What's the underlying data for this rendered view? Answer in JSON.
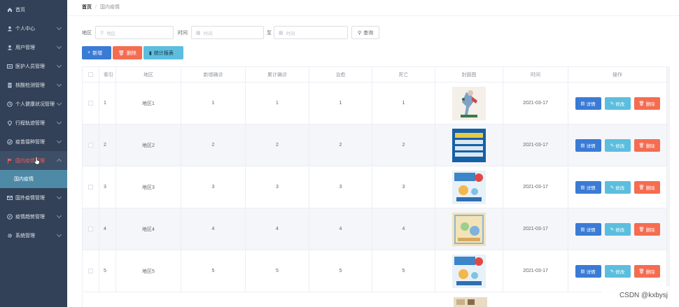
{
  "sidebar": {
    "items": [
      {
        "label": "首页",
        "icon": "home-icon",
        "arrow": false
      },
      {
        "label": "个人中心",
        "icon": "user-icon",
        "arrow": true
      },
      {
        "label": "用户管理",
        "icon": "user-icon",
        "arrow": true
      },
      {
        "label": "医护人员管理",
        "icon": "card-icon",
        "arrow": true
      },
      {
        "label": "核酸检测管理",
        "icon": "doc-icon",
        "arrow": true
      },
      {
        "label": "个人健康状况管理",
        "icon": "health-icon",
        "arrow": true
      },
      {
        "label": "行程轨迹管理",
        "icon": "location-icon",
        "arrow": true
      },
      {
        "label": "疫苗接种管理",
        "icon": "shield-icon",
        "arrow": true
      },
      {
        "label": "国内疫情管理",
        "icon": "flag-icon",
        "arrow": true,
        "active": true
      },
      {
        "label": "国外疫情管理",
        "icon": "mail-icon",
        "arrow": true
      },
      {
        "label": "疫情趋势管理",
        "icon": "compass-icon",
        "arrow": true
      },
      {
        "label": "系统管理",
        "icon": "gear-icon",
        "arrow": true
      }
    ],
    "submenu_label": "国内疫情"
  },
  "breadcrumb": {
    "home": "首页",
    "sep": "/",
    "current": "国内疫情"
  },
  "search": {
    "region_label": "地区",
    "region_placeholder": "地区",
    "time_label": "时间",
    "time_start_placeholder": "时间",
    "to_label": "至",
    "time_end_placeholder": "时间",
    "query_label": "查询"
  },
  "actions": {
    "add": "新增",
    "delete": "删除",
    "report": "统计报表"
  },
  "table": {
    "headers": [
      "索引",
      "地区",
      "新增确诊",
      "累计确诊",
      "治愈",
      "死亡",
      "封面图",
      "时间",
      "操作"
    ],
    "rows": [
      {
        "index": "1",
        "region": "地区1",
        "new_confirmed": "1",
        "total_confirmed": "1",
        "cured": "1",
        "deaths": "1",
        "time": "2021-03-17"
      },
      {
        "index": "2",
        "region": "地区2",
        "new_confirmed": "2",
        "total_confirmed": "2",
        "cured": "2",
        "deaths": "2",
        "time": "2021-03-17"
      },
      {
        "index": "3",
        "region": "地区3",
        "new_confirmed": "3",
        "total_confirmed": "3",
        "cured": "3",
        "deaths": "3",
        "time": "2021-03-17"
      },
      {
        "index": "4",
        "region": "地区4",
        "new_confirmed": "4",
        "total_confirmed": "4",
        "cured": "4",
        "deaths": "4",
        "time": "2021-03-17"
      },
      {
        "index": "5",
        "region": "地区5",
        "new_confirmed": "5",
        "total_confirmed": "5",
        "cured": "5",
        "deaths": "5",
        "time": "2021-03-17"
      }
    ],
    "row_actions": {
      "detail": "详情",
      "edit": "修改",
      "delete": "删除"
    }
  },
  "watermark": "CSDN @kxbysj",
  "colors": {
    "sidebar_bg": "#324157",
    "primary": "#3a7bd5",
    "danger": "#f56c50",
    "info": "#5cbede",
    "submenu_bg": "#4e8aa6"
  }
}
